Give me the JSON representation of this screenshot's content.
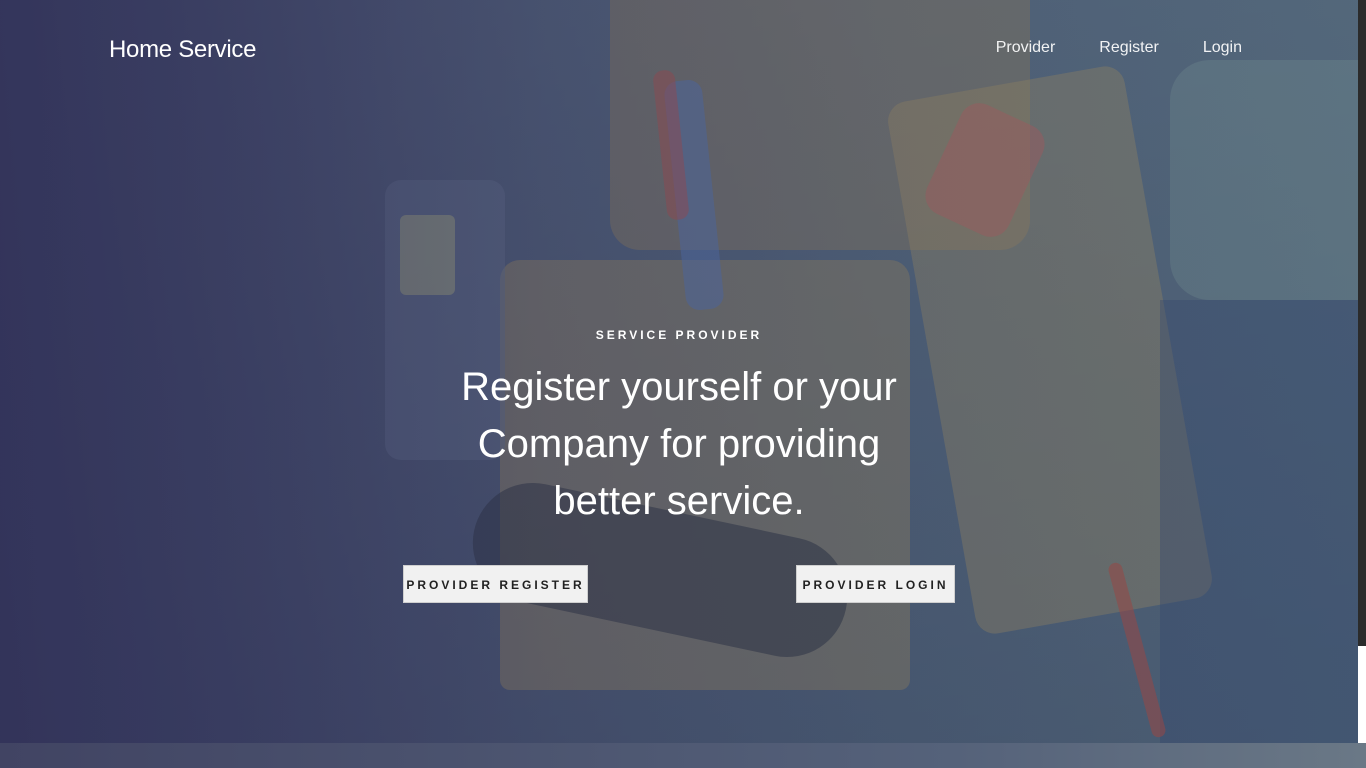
{
  "navbar": {
    "brand": "Home Service",
    "links": [
      {
        "label": "Provider"
      },
      {
        "label": "Register"
      },
      {
        "label": "Login"
      }
    ]
  },
  "hero": {
    "eyebrow": "SERVICE PROVIDER",
    "headline": "Register yourself or your Company for providing better service.",
    "buttons": {
      "register": "PROVIDER REGISTER",
      "login": "PROVIDER LOGIN"
    }
  },
  "colors": {
    "overlay": "#3f4a68",
    "button_bg": "#f1f1f1",
    "text": "#ffffff"
  }
}
